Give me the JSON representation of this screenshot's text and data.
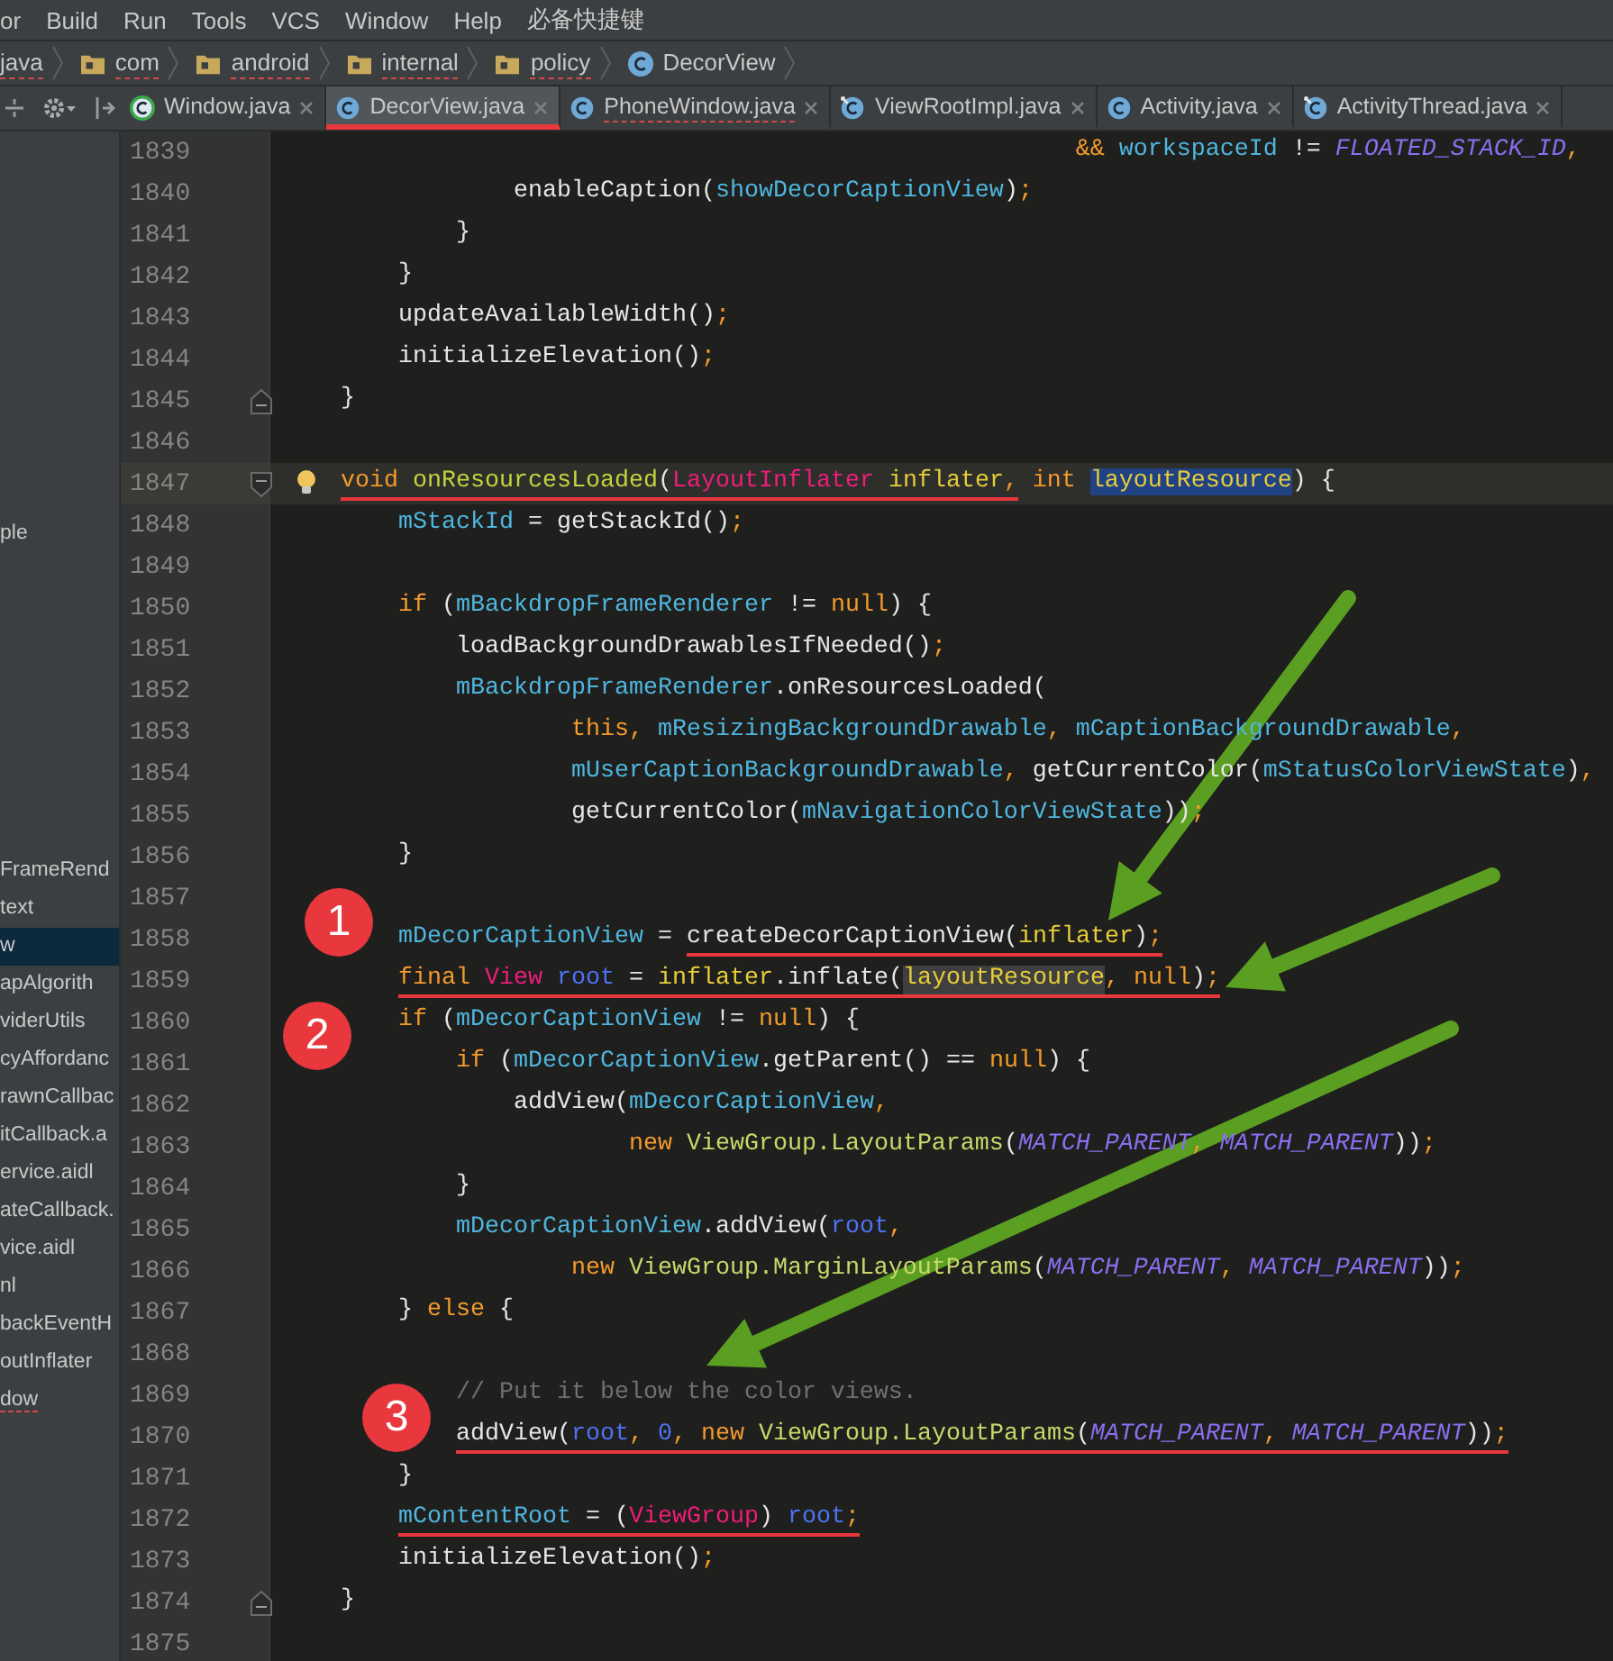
{
  "menu": [
    "or",
    "Build",
    "Run",
    "Tools",
    "VCS",
    "Window",
    "Help",
    "必备快捷键"
  ],
  "breadcrumbs": [
    {
      "label": "java",
      "kind": "none",
      "has_errors": true
    },
    {
      "label": "com",
      "kind": "folder",
      "has_errors": true
    },
    {
      "label": "android",
      "kind": "folder",
      "has_errors": true
    },
    {
      "label": "internal",
      "kind": "folder",
      "has_errors": true
    },
    {
      "label": "policy",
      "kind": "folder",
      "has_errors": true
    },
    {
      "label": "DecorView",
      "kind": "class",
      "has_errors": false
    }
  ],
  "tabs": [
    {
      "label": "Window.java",
      "kind": "abstract",
      "selected": false,
      "has_errors": false
    },
    {
      "label": "DecorView.java",
      "kind": "class",
      "selected": true,
      "has_errors": false
    },
    {
      "label": "PhoneWindow.java",
      "kind": "class",
      "selected": false,
      "has_errors": true
    },
    {
      "label": "ViewRootImpl.java",
      "kind": "final",
      "selected": false,
      "has_errors": false
    },
    {
      "label": "Activity.java",
      "kind": "class",
      "selected": false,
      "has_errors": false
    },
    {
      "label": "ActivityThread.java",
      "kind": "final",
      "selected": false,
      "has_errors": false
    }
  ],
  "project_tree": {
    "upper_items": [
      {
        "label": "ple",
        "selected": false,
        "has_errors": false
      }
    ],
    "items": [
      {
        "label": "FrameRend",
        "selected": false,
        "has_errors": false
      },
      {
        "label": "text",
        "selected": false,
        "has_errors": false
      },
      {
        "label": "w",
        "selected": true,
        "has_errors": false
      },
      {
        "label": "apAlgorith",
        "selected": false,
        "has_errors": false
      },
      {
        "label": "viderUtils",
        "selected": false,
        "has_errors": false
      },
      {
        "label": "cyAffordanc",
        "selected": false,
        "has_errors": false
      },
      {
        "label": "rawnCallbac",
        "selected": false,
        "has_errors": false
      },
      {
        "label": "itCallback.a",
        "selected": false,
        "has_errors": false
      },
      {
        "label": "ervice.aidl",
        "selected": false,
        "has_errors": false
      },
      {
        "label": "ateCallback.",
        "selected": false,
        "has_errors": false
      },
      {
        "label": "vice.aidl",
        "selected": false,
        "has_errors": false
      },
      {
        "label": "nl",
        "selected": false,
        "has_errors": false
      },
      {
        "label": "backEventH",
        "selected": false,
        "has_errors": false
      },
      {
        "label": "outInflater",
        "selected": false,
        "has_errors": false
      },
      {
        "label": "dow",
        "selected": false,
        "has_errors": true
      }
    ]
  },
  "lines": [
    {
      "number": "1839",
      "tokens": [
        {
          "text": "                                                       &&",
          "kind": "kw"
        },
        {
          "text": " workspaceId",
          "kind": "field"
        },
        {
          "text": " != ",
          "kind": "plain"
        },
        {
          "text": "FLOATED_STACK_ID",
          "kind": "const"
        },
        {
          "text": ",",
          "kind": "punct"
        }
      ]
    },
    {
      "number": "1840",
      "tokens": [
        {
          "text": "                enableCaption(",
          "kind": "plain"
        },
        {
          "text": "showDecorCaptionView",
          "kind": "field"
        },
        {
          "text": ")",
          "kind": "plain"
        },
        {
          "text": ";",
          "kind": "punct"
        }
      ]
    },
    {
      "number": "1841",
      "tokens": [
        {
          "text": "            }",
          "kind": "plain"
        }
      ]
    },
    {
      "number": "1842",
      "tokens": [
        {
          "text": "        }",
          "kind": "plain"
        }
      ]
    },
    {
      "number": "1843",
      "tokens": [
        {
          "text": "        updateAvailableWidth()",
          "kind": "plain"
        },
        {
          "text": ";",
          "kind": "punct"
        }
      ]
    },
    {
      "number": "1844",
      "tokens": [
        {
          "text": "        initializeElevation()",
          "kind": "plain"
        },
        {
          "text": ";",
          "kind": "punct"
        }
      ]
    },
    {
      "number": "1845",
      "fold_end": true,
      "tokens": [
        {
          "text": "    }",
          "kind": "plain"
        }
      ]
    },
    {
      "number": "1846"
    },
    {
      "number": "1847",
      "fold_start": true,
      "current": true,
      "intention": true,
      "tokens": [
        {
          "text": "    void",
          "kind": "kw",
          "underlined": true
        },
        {
          "text": " onResourcesLoaded",
          "kind": "method",
          "underlined": true
        },
        {
          "text": "(",
          "kind": "plain",
          "underlined": true
        },
        {
          "text": "LayoutInflater",
          "kind": "type",
          "underlined": true
        },
        {
          "text": " inflater",
          "kind": "param",
          "underlined": true
        },
        {
          "text": ",",
          "kind": "punct",
          "underlined": true
        },
        {
          "text": " int ",
          "kind": "kw"
        },
        {
          "text": "layoutResource",
          "kind": "param",
          "selected_occurrence": true
        },
        {
          "text": ") {",
          "kind": "plain"
        }
      ]
    },
    {
      "number": "1848",
      "tokens": [
        {
          "text": "        mStackId",
          "kind": "field"
        },
        {
          "text": " = getStackId()",
          "kind": "plain"
        },
        {
          "text": ";",
          "kind": "punct"
        }
      ]
    },
    {
      "number": "1849"
    },
    {
      "number": "1850",
      "tokens": [
        {
          "text": "        if",
          "kind": "kw"
        },
        {
          "text": " (",
          "kind": "plain"
        },
        {
          "text": "mBackdropFrameRenderer",
          "kind": "field"
        },
        {
          "text": " != ",
          "kind": "plain"
        },
        {
          "text": "null",
          "kind": "kw"
        },
        {
          "text": ") {",
          "kind": "plain"
        }
      ]
    },
    {
      "number": "1851",
      "tokens": [
        {
          "text": "            loadBackgroundDrawablesIfNeeded()",
          "kind": "plain"
        },
        {
          "text": ";",
          "kind": "punct"
        }
      ]
    },
    {
      "number": "1852",
      "tokens": [
        {
          "text": "            mBackdropFrameRenderer",
          "kind": "field"
        },
        {
          "text": ".onResourcesLoaded(",
          "kind": "plain"
        }
      ]
    },
    {
      "number": "1853",
      "tokens": [
        {
          "text": "                    this",
          "kind": "kw"
        },
        {
          "text": ",",
          "kind": "punct"
        },
        {
          "text": " mResizingBackgroundDrawable",
          "kind": "field"
        },
        {
          "text": ",",
          "kind": "punct"
        },
        {
          "text": " mCaptionBackgroundDrawable",
          "kind": "field"
        },
        {
          "text": ",",
          "kind": "punct"
        }
      ]
    },
    {
      "number": "1854",
      "tokens": [
        {
          "text": "                    mUserCaptionBackgroundDrawable",
          "kind": "field"
        },
        {
          "text": ",",
          "kind": "punct"
        },
        {
          "text": " getCurrentColor(",
          "kind": "plain"
        },
        {
          "text": "mStatusColorViewState",
          "kind": "field"
        },
        {
          "text": ")",
          "kind": "plain"
        },
        {
          "text": ",",
          "kind": "punct"
        }
      ]
    },
    {
      "number": "1855",
      "tokens": [
        {
          "text": "                    getCurrentColor(",
          "kind": "plain"
        },
        {
          "text": "mNavigationColorViewState",
          "kind": "field"
        },
        {
          "text": "))",
          "kind": "plain"
        },
        {
          "text": ";",
          "kind": "punct"
        }
      ]
    },
    {
      "number": "1856",
      "tokens": [
        {
          "text": "        }",
          "kind": "plain"
        }
      ]
    },
    {
      "number": "1857"
    },
    {
      "number": "1858",
      "marker": "1",
      "tokens": [
        {
          "text": "        mDecorCaptionView",
          "kind": "field"
        },
        {
          "text": " = ",
          "kind": "plain"
        },
        {
          "text": "createDecorCaptionView(",
          "kind": "plain",
          "underlined": true
        },
        {
          "text": "inflater",
          "kind": "param",
          "underlined": true
        },
        {
          "text": ")",
          "kind": "plain",
          "underlined": true
        },
        {
          "text": ";",
          "kind": "punct",
          "underlined": true
        }
      ]
    },
    {
      "number": "1859",
      "tokens": [
        {
          "text": "        final",
          "kind": "kw",
          "underlined": true
        },
        {
          "text": " View",
          "kind": "type",
          "underlined": true
        },
        {
          "text": " root",
          "kind": "local",
          "underlined": true
        },
        {
          "text": " = ",
          "kind": "plain",
          "underlined": true
        },
        {
          "text": "inflater",
          "kind": "param",
          "underlined": true
        },
        {
          "text": ".inflate(",
          "kind": "plain",
          "underlined": true
        },
        {
          "text": "layoutResource",
          "kind": "param",
          "underlined": true,
          "usage_highlight": true
        },
        {
          "text": ",",
          "kind": "punct",
          "underlined": true
        },
        {
          "text": " null",
          "kind": "kw",
          "underlined": true
        },
        {
          "text": ")",
          "kind": "plain",
          "underlined": true
        },
        {
          "text": ";",
          "kind": "punct",
          "underlined": true
        }
      ]
    },
    {
      "number": "1860",
      "marker": "2",
      "tokens": [
        {
          "text": "        if",
          "kind": "kw"
        },
        {
          "text": " (",
          "kind": "plain"
        },
        {
          "text": "mDecorCaptionView",
          "kind": "field"
        },
        {
          "text": " != ",
          "kind": "plain"
        },
        {
          "text": "null",
          "kind": "kw"
        },
        {
          "text": ") {",
          "kind": "plain"
        }
      ]
    },
    {
      "number": "1861",
      "tokens": [
        {
          "text": "            if",
          "kind": "kw"
        },
        {
          "text": " (",
          "kind": "plain"
        },
        {
          "text": "mDecorCaptionView",
          "kind": "field"
        },
        {
          "text": ".getParent() == ",
          "kind": "plain"
        },
        {
          "text": "null",
          "kind": "kw"
        },
        {
          "text": ") {",
          "kind": "plain"
        }
      ]
    },
    {
      "number": "1862",
      "tokens": [
        {
          "text": "                addView(",
          "kind": "plain"
        },
        {
          "text": "mDecorCaptionView",
          "kind": "field"
        },
        {
          "text": ",",
          "kind": "punct"
        }
      ]
    },
    {
      "number": "1863",
      "tokens": [
        {
          "text": "                        new",
          "kind": "kw"
        },
        {
          "text": " ViewGroup.LayoutParams",
          "kind": "ctor"
        },
        {
          "text": "(",
          "kind": "plain"
        },
        {
          "text": "MATCH_PARENT",
          "kind": "const"
        },
        {
          "text": ",",
          "kind": "punct"
        },
        {
          "text": " MATCH_PARENT",
          "kind": "const"
        },
        {
          "text": "))",
          "kind": "plain"
        },
        {
          "text": ";",
          "kind": "punct"
        }
      ]
    },
    {
      "number": "1864",
      "tokens": [
        {
          "text": "            }",
          "kind": "plain"
        }
      ]
    },
    {
      "number": "1865",
      "tokens": [
        {
          "text": "            mDecorCaptionView",
          "kind": "field"
        },
        {
          "text": ".addView(",
          "kind": "plain"
        },
        {
          "text": "root",
          "kind": "local"
        },
        {
          "text": ",",
          "kind": "punct"
        }
      ]
    },
    {
      "number": "1866",
      "tokens": [
        {
          "text": "                    new",
          "kind": "kw"
        },
        {
          "text": " ViewGroup.MarginLayoutParams",
          "kind": "ctor"
        },
        {
          "text": "(",
          "kind": "plain"
        },
        {
          "text": "MATCH_PARENT",
          "kind": "const"
        },
        {
          "text": ",",
          "kind": "punct"
        },
        {
          "text": " MATCH_PARENT",
          "kind": "const"
        },
        {
          "text": "))",
          "kind": "plain"
        },
        {
          "text": ";",
          "kind": "punct"
        }
      ]
    },
    {
      "number": "1867",
      "tokens": [
        {
          "text": "        } ",
          "kind": "plain"
        },
        {
          "text": "else",
          "kind": "kw"
        },
        {
          "text": " {",
          "kind": "plain"
        }
      ]
    },
    {
      "number": "1868"
    },
    {
      "number": "1869",
      "tokens": [
        {
          "text": "            // Put it below the color views.",
          "kind": "comment"
        }
      ]
    },
    {
      "number": "1870",
      "marker": "3",
      "tokens": [
        {
          "text": "            addView(",
          "kind": "plain",
          "underlined": true
        },
        {
          "text": "root",
          "kind": "local",
          "underlined": true
        },
        {
          "text": ",",
          "kind": "punct",
          "underlined": true
        },
        {
          "text": " 0",
          "kind": "num",
          "underlined": true
        },
        {
          "text": ",",
          "kind": "punct",
          "underlined": true
        },
        {
          "text": " new",
          "kind": "kw",
          "underlined": true
        },
        {
          "text": " ViewGroup.LayoutParams",
          "kind": "ctor",
          "underlined": true
        },
        {
          "text": "(",
          "kind": "plain",
          "underlined": true
        },
        {
          "text": "MATCH_PARENT",
          "kind": "const",
          "underlined": true
        },
        {
          "text": ",",
          "kind": "punct",
          "underlined": true
        },
        {
          "text": " MATCH_PARENT",
          "kind": "const",
          "underlined": true
        },
        {
          "text": "))",
          "kind": "plain",
          "underlined": true
        },
        {
          "text": ";",
          "kind": "punct",
          "underlined": true
        }
      ]
    },
    {
      "number": "1871",
      "tokens": [
        {
          "text": "        }",
          "kind": "plain"
        }
      ]
    },
    {
      "number": "1872",
      "tokens": [
        {
          "text": "        mContentRoot",
          "kind": "field",
          "underlined": true
        },
        {
          "text": " = (",
          "kind": "plain",
          "underlined": true
        },
        {
          "text": "ViewGroup",
          "kind": "type",
          "underlined": true
        },
        {
          "text": ") ",
          "kind": "plain",
          "underlined": true
        },
        {
          "text": "root",
          "kind": "local",
          "underlined": true
        },
        {
          "text": ";",
          "kind": "punct",
          "underlined": true
        }
      ]
    },
    {
      "number": "1873",
      "tokens": [
        {
          "text": "        initializeElevation()",
          "kind": "plain"
        },
        {
          "text": ";",
          "kind": "punct"
        }
      ]
    },
    {
      "number": "1874",
      "fold_end": true,
      "tokens": [
        {
          "text": "    }",
          "kind": "plain"
        }
      ]
    },
    {
      "number": "1875"
    }
  ]
}
